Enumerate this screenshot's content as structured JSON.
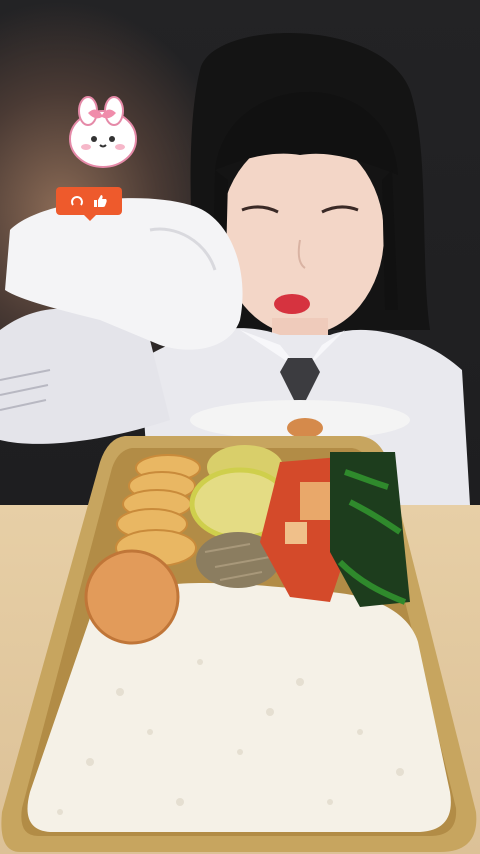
{
  "scene": {
    "description_icons": [
      "bunny-sticker-icon",
      "like-thumb-icon"
    ],
    "colors": {
      "badge": "#ee5a2c",
      "tray": "#c9a866",
      "rice": "#f6f2e8",
      "table": "#e3c89e"
    }
  }
}
